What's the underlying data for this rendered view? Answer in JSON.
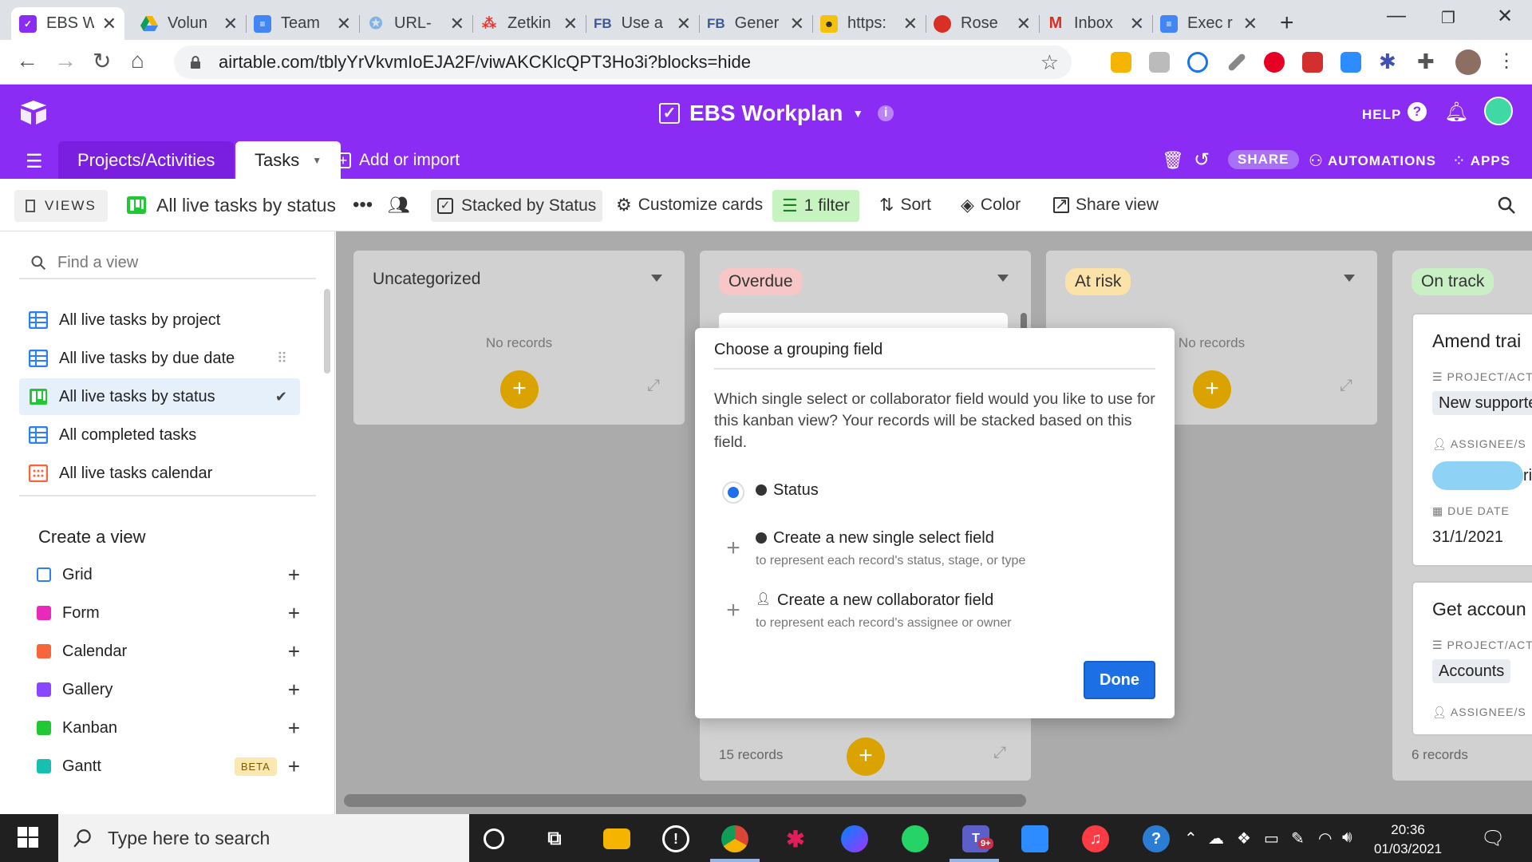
{
  "browser": {
    "tabs": [
      {
        "label": "EBS W",
        "favicon": "airtable",
        "color": "#8b2cf5",
        "active": true
      },
      {
        "label": "Volun",
        "favicon": "google-drive",
        "color": "#f4b400"
      },
      {
        "label": "Team",
        "favicon": "google-docs",
        "color": "#4285f4"
      },
      {
        "label": "URL-",
        "favicon": "url-shortener",
        "color": "#7fb3e8"
      },
      {
        "label": "Zetkin",
        "favicon": "zetkin",
        "color": "#e53935"
      },
      {
        "label": "Use a",
        "favicon": "facebook",
        "color": "#3b5998"
      },
      {
        "label": "Gener",
        "favicon": "facebook",
        "color": "#3b5998"
      },
      {
        "label": "https:",
        "favicon": "theatre",
        "color": "#333333"
      },
      {
        "label": "Rose",
        "favicon": "rose",
        "color": "#d93025"
      },
      {
        "label": "Inbox",
        "favicon": "gmail",
        "color": "#d93025"
      },
      {
        "label": "Exec r",
        "favicon": "google-docs",
        "color": "#4285f4"
      }
    ],
    "url": "airtable.com/tblyYrVkvmIoEJA2F/viwAKCKlcQPT3Ho3i?blocks=hide"
  },
  "app": {
    "base_title": "EBS Workplan",
    "help_label": "HELP",
    "tables": [
      {
        "label": "Projects/Activities",
        "active": false
      },
      {
        "label": "Tasks",
        "active": true
      }
    ],
    "add_import_label": "Add or import",
    "share_label": "SHARE",
    "automations_label": "AUTOMATIONS",
    "apps_label": "APPS",
    "accent": "#8b2cf5"
  },
  "viewbar": {
    "views_label": "VIEWS",
    "current_view": "All live tasks by status",
    "stacked_label": "Stacked by Status",
    "customize_label": "Customize cards",
    "filter_label": "1 filter",
    "sort_label": "Sort",
    "color_label": "Color",
    "share_view_label": "Share view"
  },
  "sidebar": {
    "find_placeholder": "Find a view",
    "views": [
      {
        "label": "All live tasks by project",
        "type": "grid"
      },
      {
        "label": "All live tasks by due date",
        "type": "grid"
      },
      {
        "label": "All live tasks by status",
        "type": "kanban",
        "selected": true
      },
      {
        "label": "All completed tasks",
        "type": "grid"
      },
      {
        "label": "All live tasks calendar",
        "type": "calendar"
      }
    ],
    "create_header": "Create a view",
    "create_items": [
      {
        "label": "Grid",
        "color": "#2d7ff9"
      },
      {
        "label": "Form",
        "color": "#e929ba"
      },
      {
        "label": "Calendar",
        "color": "#f7653b"
      },
      {
        "label": "Gallery",
        "color": "#8b46ff"
      },
      {
        "label": "Kanban",
        "color": "#20c933"
      },
      {
        "label": "Gantt",
        "color": "#18bfb0",
        "badge": "BETA"
      }
    ]
  },
  "board": {
    "columns": [
      {
        "label": "Uncategorized",
        "empty_text": "No records"
      },
      {
        "label": "Overdue",
        "pill_color": "#f7c6c6",
        "record_count": "15 records"
      },
      {
        "label": "At risk",
        "pill_color": "#fbe2a8",
        "empty_text": "No records"
      },
      {
        "label": "On track",
        "pill_color": "#c9f0c5",
        "record_count": "6 records"
      }
    ],
    "cards": [
      {
        "title": "Amend trai",
        "project_label": "PROJECT/ACT",
        "project_value": "New supporte",
        "assignee_label": "ASSIGNEE/S",
        "assignee_value": "ri",
        "due_label": "DUE DATE",
        "due_value": "31/1/2021"
      },
      {
        "title": "Get accoun",
        "project_label": "PROJECT/ACT",
        "project_value": "Accounts",
        "assignee_label": "ASSIGNEE/S"
      }
    ]
  },
  "modal": {
    "title": "Choose a grouping field",
    "description": "Which single select or collaborator field would you like to use for this kanban view? Your records will be stacked based on this field.",
    "options": [
      {
        "label": "Status",
        "selected": true
      },
      {
        "label": "Create a new single select field",
        "sub": "to represent each record's status, stage, or type"
      },
      {
        "label": "Create a new collaborator field",
        "sub": "to represent each record's assignee or owner"
      }
    ],
    "done_label": "Done"
  },
  "taskbar": {
    "search_placeholder": "Type here to search",
    "time": "20:36",
    "date": "01/03/2021",
    "teams_badge": "9+"
  }
}
